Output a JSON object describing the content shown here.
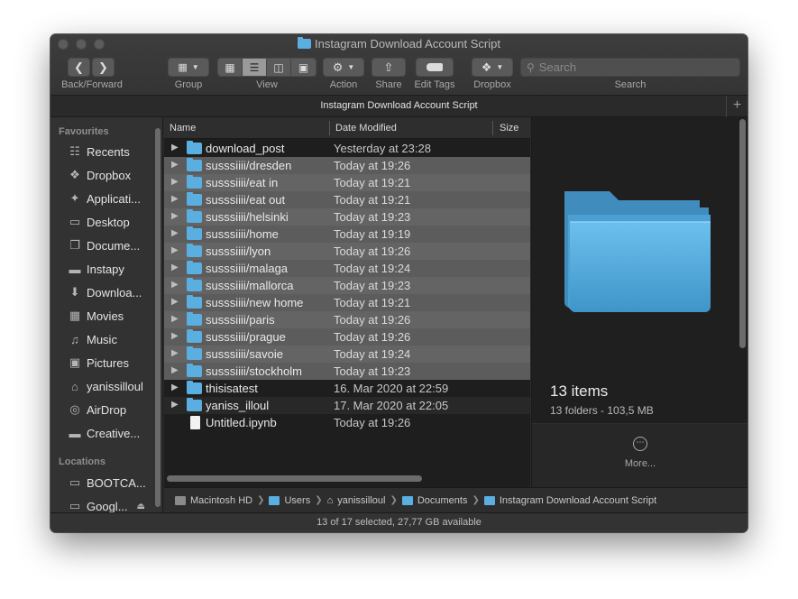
{
  "window": {
    "title": "Instagram Download Account Script"
  },
  "toolbar": {
    "back_forward_label": "Back/Forward",
    "group_label": "Group",
    "view_label": "View",
    "action_label": "Action",
    "share_label": "Share",
    "edit_tags_label": "Edit Tags",
    "dropbox_label": "Dropbox",
    "search_label": "Search",
    "search_placeholder": "Search"
  },
  "tabbar": {
    "title": "Instagram Download Account Script",
    "add_symbol": "+"
  },
  "sidebar": {
    "favourites_heading": "Favourites",
    "favourites": [
      {
        "label": "Recents",
        "icon": "recents-icon"
      },
      {
        "label": "Dropbox",
        "icon": "dropbox-icon"
      },
      {
        "label": "Applicati...",
        "icon": "applications-icon"
      },
      {
        "label": "Desktop",
        "icon": "desktop-icon"
      },
      {
        "label": "Docume...",
        "icon": "documents-icon"
      },
      {
        "label": "Instapy",
        "icon": "folder-icon"
      },
      {
        "label": "Downloa...",
        "icon": "downloads-icon"
      },
      {
        "label": "Movies",
        "icon": "movies-icon"
      },
      {
        "label": "Music",
        "icon": "music-icon"
      },
      {
        "label": "Pictures",
        "icon": "pictures-icon"
      },
      {
        "label": "yanissilloul",
        "icon": "home-icon"
      },
      {
        "label": "AirDrop",
        "icon": "airdrop-icon"
      },
      {
        "label": "Creative...",
        "icon": "folder-icon"
      }
    ],
    "locations_heading": "Locations",
    "locations": [
      {
        "label": "BOOTCA...",
        "icon": "drive-icon"
      },
      {
        "label": "Googl...",
        "icon": "drive-icon"
      }
    ]
  },
  "columns": {
    "name": "Name",
    "date": "Date Modified",
    "size": "Size"
  },
  "files": [
    {
      "name": "download_post",
      "date": "Yesterday at 23:28",
      "kind": "folder",
      "selected": false
    },
    {
      "name": "susssiiii/dresden",
      "date": "Today at 19:26",
      "kind": "folder",
      "selected": true
    },
    {
      "name": "susssiiii/eat in",
      "date": "Today at 19:21",
      "kind": "folder",
      "selected": true
    },
    {
      "name": "susssiiii/eat out",
      "date": "Today at 19:21",
      "kind": "folder",
      "selected": true
    },
    {
      "name": "susssiiii/helsinki",
      "date": "Today at 19:23",
      "kind": "folder",
      "selected": true
    },
    {
      "name": "susssiiii/home",
      "date": "Today at 19:19",
      "kind": "folder",
      "selected": true
    },
    {
      "name": "susssiiii/lyon",
      "date": "Today at 19:26",
      "kind": "folder",
      "selected": true
    },
    {
      "name": "susssiiii/malaga",
      "date": "Today at 19:24",
      "kind": "folder",
      "selected": true
    },
    {
      "name": "susssiiii/mallorca",
      "date": "Today at 19:23",
      "kind": "folder",
      "selected": true
    },
    {
      "name": "susssiiii/new home",
      "date": "Today at 19:21",
      "kind": "folder",
      "selected": true
    },
    {
      "name": "susssiiii/paris",
      "date": "Today at 19:26",
      "kind": "folder",
      "selected": true
    },
    {
      "name": "susssiiii/prague",
      "date": "Today at 19:26",
      "kind": "folder",
      "selected": true
    },
    {
      "name": "susssiiii/savoie",
      "date": "Today at 19:24",
      "kind": "folder",
      "selected": true
    },
    {
      "name": "susssiiii/stockholm",
      "date": "Today at 19:23",
      "kind": "folder",
      "selected": true
    },
    {
      "name": "thisisatest",
      "date": "16. Mar 2020 at 22:59",
      "kind": "folder",
      "selected": false
    },
    {
      "name": "yaniss_illoul",
      "date": "17. Mar 2020 at 22:05",
      "kind": "folder",
      "selected": false
    },
    {
      "name": "Untitled.ipynb",
      "date": "Today at 19:26",
      "kind": "file",
      "selected": false
    }
  ],
  "preview": {
    "title": "13 items",
    "subtitle": "13 folders - 103,5 MB",
    "more_label": "More..."
  },
  "pathbar": {
    "segments": [
      {
        "label": "Macintosh HD",
        "icon": "drive-icon"
      },
      {
        "label": "Users",
        "icon": "folder-icon"
      },
      {
        "label": "yanissilloul",
        "icon": "home-icon"
      },
      {
        "label": "Documents",
        "icon": "folder-icon"
      },
      {
        "label": "Instagram Download Account Script",
        "icon": "folder-icon"
      }
    ]
  },
  "status": {
    "text": "13 of 17 selected, 27,77 GB available"
  },
  "colors": {
    "folder_blue": "#5aaee0",
    "selection_gray": "#646464"
  }
}
